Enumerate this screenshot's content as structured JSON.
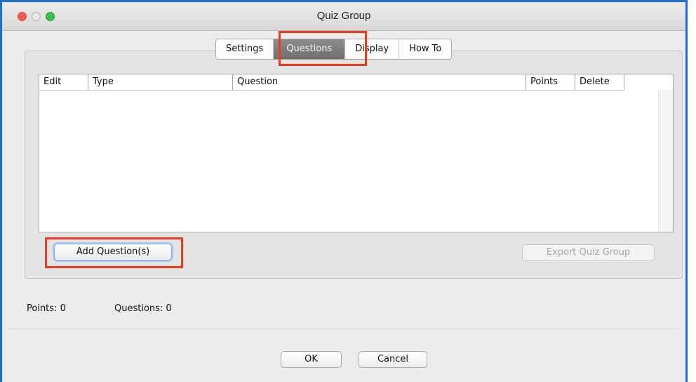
{
  "window": {
    "title": "Quiz Group"
  },
  "tabs": [
    {
      "label": "Settings",
      "selected": false
    },
    {
      "label": "Questions",
      "selected": true
    },
    {
      "label": "Display",
      "selected": false
    },
    {
      "label": "How To",
      "selected": false
    }
  ],
  "table": {
    "columns": [
      "Edit",
      "Type",
      "Question",
      "Points",
      "Delete"
    ],
    "rows": []
  },
  "buttons": {
    "add_question": "Add Question(s)",
    "export_quiz_group": "Export Quiz Group",
    "ok": "OK",
    "cancel": "Cancel"
  },
  "status": {
    "points": "Points: 0",
    "questions": "Questions: 0"
  },
  "colors": {
    "highlight": "#ea3a22",
    "window_border": "#1c6fd0",
    "selected_tab": "#7d7d7d"
  }
}
